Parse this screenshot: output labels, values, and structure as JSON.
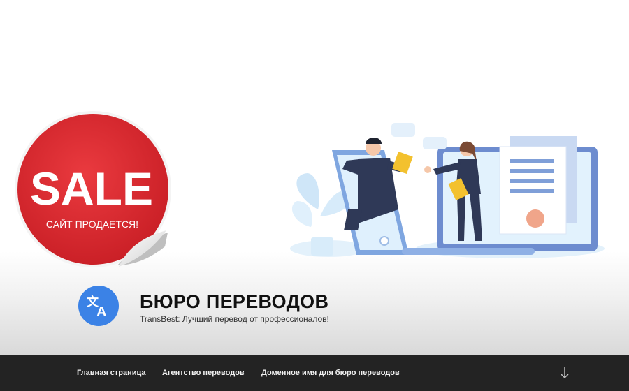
{
  "sale_badge": {
    "big": "SALE",
    "small": "САЙТ ПРОДАЕТСЯ!"
  },
  "site": {
    "title": "БЮРО ПЕРЕВОДОВ",
    "tagline": "TransBest: Лучший перевод от профессионалов!",
    "logo_icon": "translate-icon"
  },
  "nav": {
    "items": [
      {
        "label": "Главная страница"
      },
      {
        "label": "Агентство переводов"
      },
      {
        "label": "Доменное имя для бюро переводов"
      }
    ],
    "scroll_icon": "arrow-down-icon"
  },
  "colors": {
    "nav_bg": "#232323",
    "sale_red": "#d9262c",
    "logo_blue": "#3b82e6",
    "illustration_blue": "#6d8ccf"
  }
}
